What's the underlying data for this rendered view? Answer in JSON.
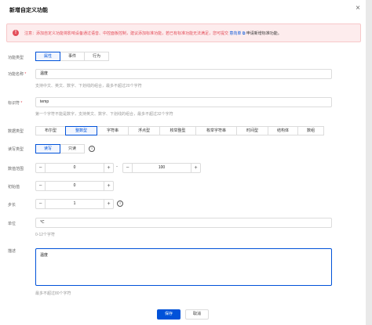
{
  "dialog": {
    "title": "新增自定义功能",
    "close_icon": "×"
  },
  "notice": {
    "icon": "!",
    "text": "注意：添加自定义功能将影响设备通过语音、中控面板控制，建议添加标准功能，若已有标准功能无法满足，您可提交",
    "link": "意向单",
    "link_icon": "⧉",
    "link2": "申请新增标准功能。"
  },
  "function_type": {
    "label": "功能类型",
    "options": [
      "属性",
      "事件",
      "行为"
    ],
    "selected": "属性"
  },
  "function_name": {
    "label": "功能名称",
    "required_mark": "*",
    "value": "温度",
    "hint": "支持中文、英文、数字、下划线的组合，最多不超过20个字符"
  },
  "identifier": {
    "label": "标识符",
    "required_mark": "*",
    "value": "temp",
    "hint": "第一个字符不能是数字，支持英文、数字、下划线的组合，最多不超过32个字符"
  },
  "data_type": {
    "label": "数据类型",
    "options": [
      "布尔型",
      "整数型",
      "字符串",
      "浮点型",
      "枚举整型",
      "枚举字符串",
      "时间型",
      "结构体",
      "数组"
    ],
    "selected": "整数型"
  },
  "rw_type": {
    "label": "读写类型",
    "options": [
      "读写",
      "只读"
    ],
    "selected": "读写",
    "info_icon": "i"
  },
  "value_range": {
    "label": "数值范围",
    "min": "0",
    "max": "100",
    "separator": "-",
    "minus": "−",
    "plus": "+"
  },
  "initial_value": {
    "label": "初始值",
    "value": "0",
    "minus": "−",
    "plus": "+"
  },
  "step": {
    "label": "步长",
    "value": "1",
    "minus": "−",
    "plus": "+",
    "info_icon": "i"
  },
  "unit": {
    "label": "单位",
    "value": "℃",
    "hint": "0-12个字符"
  },
  "description": {
    "label": "描述",
    "value": "温度",
    "hint": "最多不超过80个字符"
  },
  "footer": {
    "save_label": "保存",
    "cancel_label": "取消"
  },
  "colors": {
    "primary": "#0052d9",
    "error": "#e34d59"
  }
}
